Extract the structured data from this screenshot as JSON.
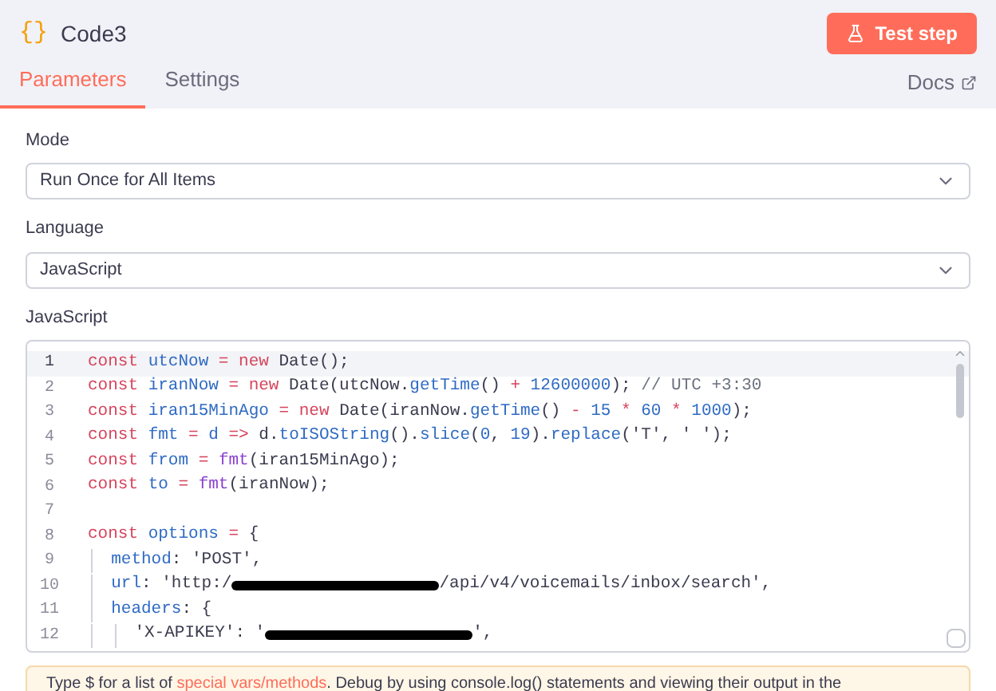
{
  "header": {
    "icon": "{}",
    "title": "Code3",
    "button": "Test step"
  },
  "tabs": [
    {
      "label": "Parameters",
      "selected": true
    },
    {
      "label": "Settings",
      "selected": false
    }
  ],
  "docs_link": "Docs",
  "fields": [
    {
      "label": "Mode",
      "value": "Run Once for All Items"
    },
    {
      "label": "Language",
      "value": "JavaScript"
    }
  ],
  "editor": {
    "label": "JavaScript",
    "lines": [
      {
        "number": "1",
        "active": true,
        "tokens": [
          {
            "kind": "kw",
            "t": "const "
          },
          {
            "kind": "var",
            "t": "utcNow"
          },
          {
            "kind": "op",
            "t": " = "
          },
          {
            "kind": "kw",
            "t": "new "
          },
          {
            "kind": "plain",
            "t": "Date();"
          }
        ]
      },
      {
        "number": "2",
        "active": false,
        "tokens": [
          {
            "kind": "kw",
            "t": "const "
          },
          {
            "kind": "var",
            "t": "iranNow"
          },
          {
            "kind": "op",
            "t": " = "
          },
          {
            "kind": "kw",
            "t": "new "
          },
          {
            "kind": "plain",
            "t": "Date(utcNow."
          },
          {
            "kind": "var",
            "t": "getTime"
          },
          {
            "kind": "plain",
            "t": "() "
          },
          {
            "kind": "op",
            "t": "+ "
          },
          {
            "kind": "num",
            "t": "12600000"
          },
          {
            "kind": "plain",
            "t": "); "
          },
          {
            "kind": "comment",
            "t": "// UTC +3:30"
          }
        ]
      },
      {
        "number": "3",
        "active": false,
        "tokens": [
          {
            "kind": "kw",
            "t": "const "
          },
          {
            "kind": "var",
            "t": "iran15MinAgo"
          },
          {
            "kind": "op",
            "t": " = "
          },
          {
            "kind": "kw",
            "t": "new "
          },
          {
            "kind": "plain",
            "t": "Date(iranNow."
          },
          {
            "kind": "var",
            "t": "getTime"
          },
          {
            "kind": "plain",
            "t": "() "
          },
          {
            "kind": "op",
            "t": "- "
          },
          {
            "kind": "num",
            "t": "15 "
          },
          {
            "kind": "op",
            "t": "* "
          },
          {
            "kind": "num",
            "t": "60 "
          },
          {
            "kind": "op",
            "t": "* "
          },
          {
            "kind": "num",
            "t": "1000"
          },
          {
            "kind": "plain",
            "t": ");"
          }
        ]
      },
      {
        "number": "4",
        "active": false,
        "tokens": [
          {
            "kind": "kw",
            "t": "const "
          },
          {
            "kind": "var",
            "t": "fmt"
          },
          {
            "kind": "op",
            "t": " = "
          },
          {
            "kind": "var",
            "t": "d"
          },
          {
            "kind": "op",
            "t": " => "
          },
          {
            "kind": "plain",
            "t": "d."
          },
          {
            "kind": "var",
            "t": "toISOString"
          },
          {
            "kind": "plain",
            "t": "()."
          },
          {
            "kind": "var",
            "t": "slice"
          },
          {
            "kind": "plain",
            "t": "("
          },
          {
            "kind": "num",
            "t": "0"
          },
          {
            "kind": "plain",
            "t": ", "
          },
          {
            "kind": "num",
            "t": "19"
          },
          {
            "kind": "plain",
            "t": ")."
          },
          {
            "kind": "var",
            "t": "replace"
          },
          {
            "kind": "plain",
            "t": "('T', ' ');"
          }
        ]
      },
      {
        "number": "5",
        "active": false,
        "tokens": [
          {
            "kind": "kw",
            "t": "const "
          },
          {
            "kind": "var",
            "t": "from"
          },
          {
            "kind": "op",
            "t": " = "
          },
          {
            "kind": "fn",
            "t": "fmt"
          },
          {
            "kind": "plain",
            "t": "(iran15MinAgo);"
          }
        ]
      },
      {
        "number": "6",
        "active": false,
        "tokens": [
          {
            "kind": "kw",
            "t": "const "
          },
          {
            "kind": "var",
            "t": "to"
          },
          {
            "kind": "op",
            "t": " = "
          },
          {
            "kind": "fn",
            "t": "fmt"
          },
          {
            "kind": "plain",
            "t": "(iranNow);"
          }
        ]
      },
      {
        "number": "7",
        "active": false
      },
      {
        "number": "8",
        "active": false,
        "tokens": [
          {
            "kind": "kw",
            "t": "const "
          },
          {
            "kind": "var",
            "t": "options"
          },
          {
            "kind": "op",
            "t": " = "
          },
          {
            "kind": "plain",
            "t": "{"
          }
        ]
      },
      {
        "number": "9",
        "active": false,
        "tokens": [
          {
            "kind": "indent"
          },
          {
            "kind": "var",
            "t": "method"
          },
          {
            "kind": "plain",
            "t": ": 'POST',"
          }
        ]
      },
      {
        "number": "10",
        "active": false,
        "tokens": [
          {
            "kind": "indent"
          },
          {
            "kind": "var",
            "t": "url"
          },
          {
            "kind": "plain",
            "t": ": 'http:/"
          },
          {
            "kind": "redacted"
          },
          {
            "kind": "plain",
            "t": "/api/v4/voicemails/inbox/search',"
          }
        ]
      },
      {
        "number": "11",
        "active": false,
        "tokens": [
          {
            "kind": "indent"
          },
          {
            "kind": "var",
            "t": "headers"
          },
          {
            "kind": "plain",
            "t": ": {"
          }
        ]
      },
      {
        "number": "12",
        "active": false,
        "tokens": [
          {
            "kind": "indent"
          },
          {
            "kind": "indent"
          },
          {
            "kind": "plain",
            "t": "'X-APIKEY': '"
          },
          {
            "kind": "redacted"
          },
          {
            "kind": "plain",
            "t": "',"
          }
        ]
      }
    ]
  },
  "hint": "Type $ for a list of **special vars/methods**. Debug by using console.log() statements and viewing their output in the"
}
